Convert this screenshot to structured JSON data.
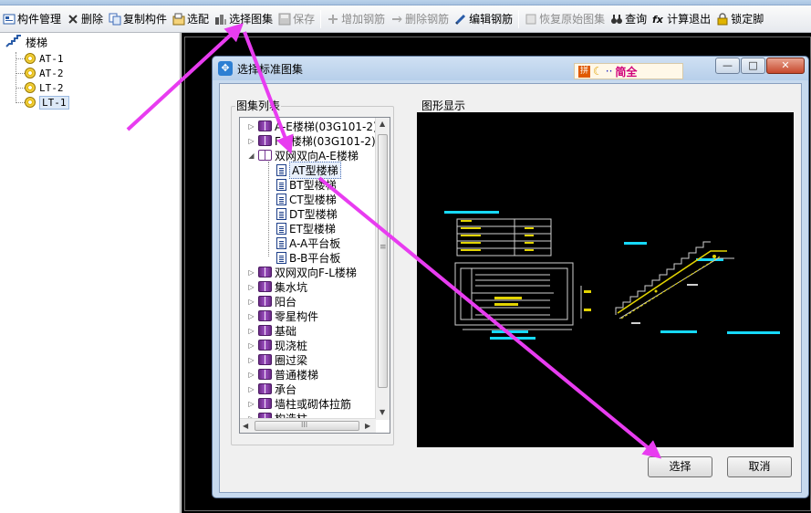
{
  "toolbar": {
    "items": [
      {
        "label": "构件管理",
        "icon": "component-manage-icon",
        "enabled": true
      },
      {
        "label": "删除",
        "icon": "delete-x-icon",
        "enabled": true
      },
      {
        "label": "复制构件",
        "icon": "copy-icon",
        "enabled": true
      },
      {
        "label": "选配",
        "icon": "select-match-icon",
        "enabled": true
      },
      {
        "label": "选择图集",
        "icon": "atlas-icon",
        "enabled": true
      },
      {
        "label": "保存",
        "icon": "save-disk-icon",
        "enabled": false
      },
      {
        "label": "增加钢筋",
        "icon": "add-rebar-icon",
        "enabled": false
      },
      {
        "label": "删除钢筋",
        "icon": "delete-rebar-icon",
        "enabled": false
      },
      {
        "label": "编辑钢筋",
        "icon": "edit-rebar-icon",
        "enabled": true
      },
      {
        "label": "恢复原始图集",
        "icon": "restore-icon",
        "enabled": false
      },
      {
        "label": "查询",
        "icon": "binoculars-icon",
        "enabled": true
      },
      {
        "label": "计算退出",
        "icon": "fx-icon",
        "enabled": true
      },
      {
        "label": "锁定脚",
        "icon": "lock-icon",
        "enabled": true
      }
    ]
  },
  "left_tree": {
    "root": "楼梯",
    "items": [
      "AT-1",
      "AT-2",
      "LT-2",
      "LT-1"
    ]
  },
  "dialog": {
    "title": "选择标准图集",
    "ime": {
      "mode": "简全"
    },
    "list_group": "图集列表",
    "preview_group": "图形显示",
    "tree": [
      {
        "label": "A-E楼梯(03G101-2)",
        "type": "book",
        "expander": "▷",
        "indent": 0
      },
      {
        "label": "F-L楼梯(03G101-2)",
        "type": "book",
        "expander": "▷",
        "indent": 0
      },
      {
        "label": "双网双向A-E楼梯",
        "type": "book-open",
        "expander": "◢",
        "indent": 0
      },
      {
        "label": "AT型楼梯",
        "type": "doc",
        "expander": "",
        "indent": 1,
        "selected": true
      },
      {
        "label": "BT型楼梯",
        "type": "doc",
        "expander": "",
        "indent": 1
      },
      {
        "label": "CT型楼梯",
        "type": "doc",
        "expander": "",
        "indent": 1
      },
      {
        "label": "DT型楼梯",
        "type": "doc",
        "expander": "",
        "indent": 1
      },
      {
        "label": "ET型楼梯",
        "type": "doc",
        "expander": "",
        "indent": 1
      },
      {
        "label": "A-A平台板",
        "type": "doc",
        "expander": "",
        "indent": 1
      },
      {
        "label": "B-B平台板",
        "type": "doc",
        "expander": "",
        "indent": 1
      },
      {
        "label": "双网双向F-L楼梯",
        "type": "book",
        "expander": "▷",
        "indent": 0
      },
      {
        "label": "集水坑",
        "type": "book",
        "expander": "▷",
        "indent": 0
      },
      {
        "label": "阳台",
        "type": "book",
        "expander": "▷",
        "indent": 0
      },
      {
        "label": "零星构件",
        "type": "book",
        "expander": "▷",
        "indent": 0
      },
      {
        "label": "基础",
        "type": "book",
        "expander": "▷",
        "indent": 0
      },
      {
        "label": "现浇桩",
        "type": "book",
        "expander": "▷",
        "indent": 0
      },
      {
        "label": "圈过梁",
        "type": "book",
        "expander": "▷",
        "indent": 0
      },
      {
        "label": "普通楼梯",
        "type": "book",
        "expander": "▷",
        "indent": 0
      },
      {
        "label": "承台",
        "type": "book",
        "expander": "▷",
        "indent": 0
      },
      {
        "label": "墙柱或砌体拉筋",
        "type": "book",
        "expander": "▷",
        "indent": 0
      },
      {
        "label": "构造柱",
        "type": "book",
        "expander": "▷",
        "indent": 0
      }
    ],
    "scroll": {
      "up": "▲",
      "down": "▼",
      "left": "◀",
      "right": "▶",
      "grip": "≡",
      "hgrip": "III"
    },
    "window_buttons": {
      "minimize": "—",
      "maximize": "□",
      "close": "✕"
    },
    "buttons": {
      "ok": "选择",
      "cancel": "取消"
    }
  },
  "annotation_color": "#e83cf0"
}
